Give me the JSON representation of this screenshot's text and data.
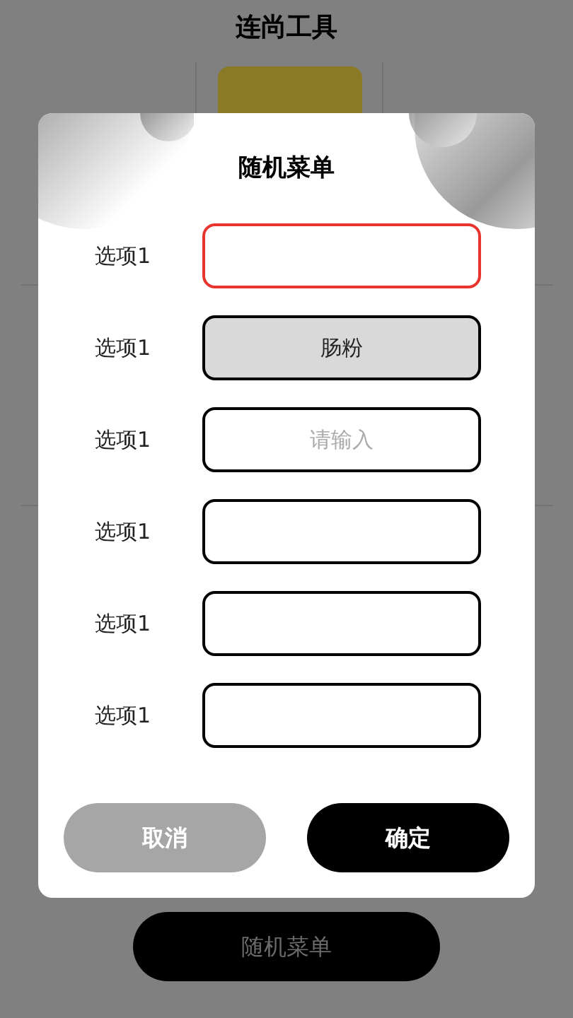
{
  "page": {
    "title": "连尚工具",
    "button": "随机菜单"
  },
  "dialog": {
    "title": "随机菜单",
    "options": [
      {
        "label": "选项1",
        "focused": true,
        "selected": false
      },
      {
        "label": "选项1",
        "value": "肠粉",
        "focused": false,
        "selected": true
      },
      {
        "label": "选项1",
        "placeholder": "请输入",
        "focused": false,
        "selected": false
      },
      {
        "label": "选项1",
        "focused": false,
        "selected": false
      },
      {
        "label": "选项1",
        "focused": false,
        "selected": false
      },
      {
        "label": "选项1",
        "focused": false,
        "selected": false
      }
    ],
    "buttons": [
      {
        "label": "取消",
        "kind": "cancel"
      },
      {
        "label": "确定",
        "kind": "confirm"
      }
    ]
  }
}
